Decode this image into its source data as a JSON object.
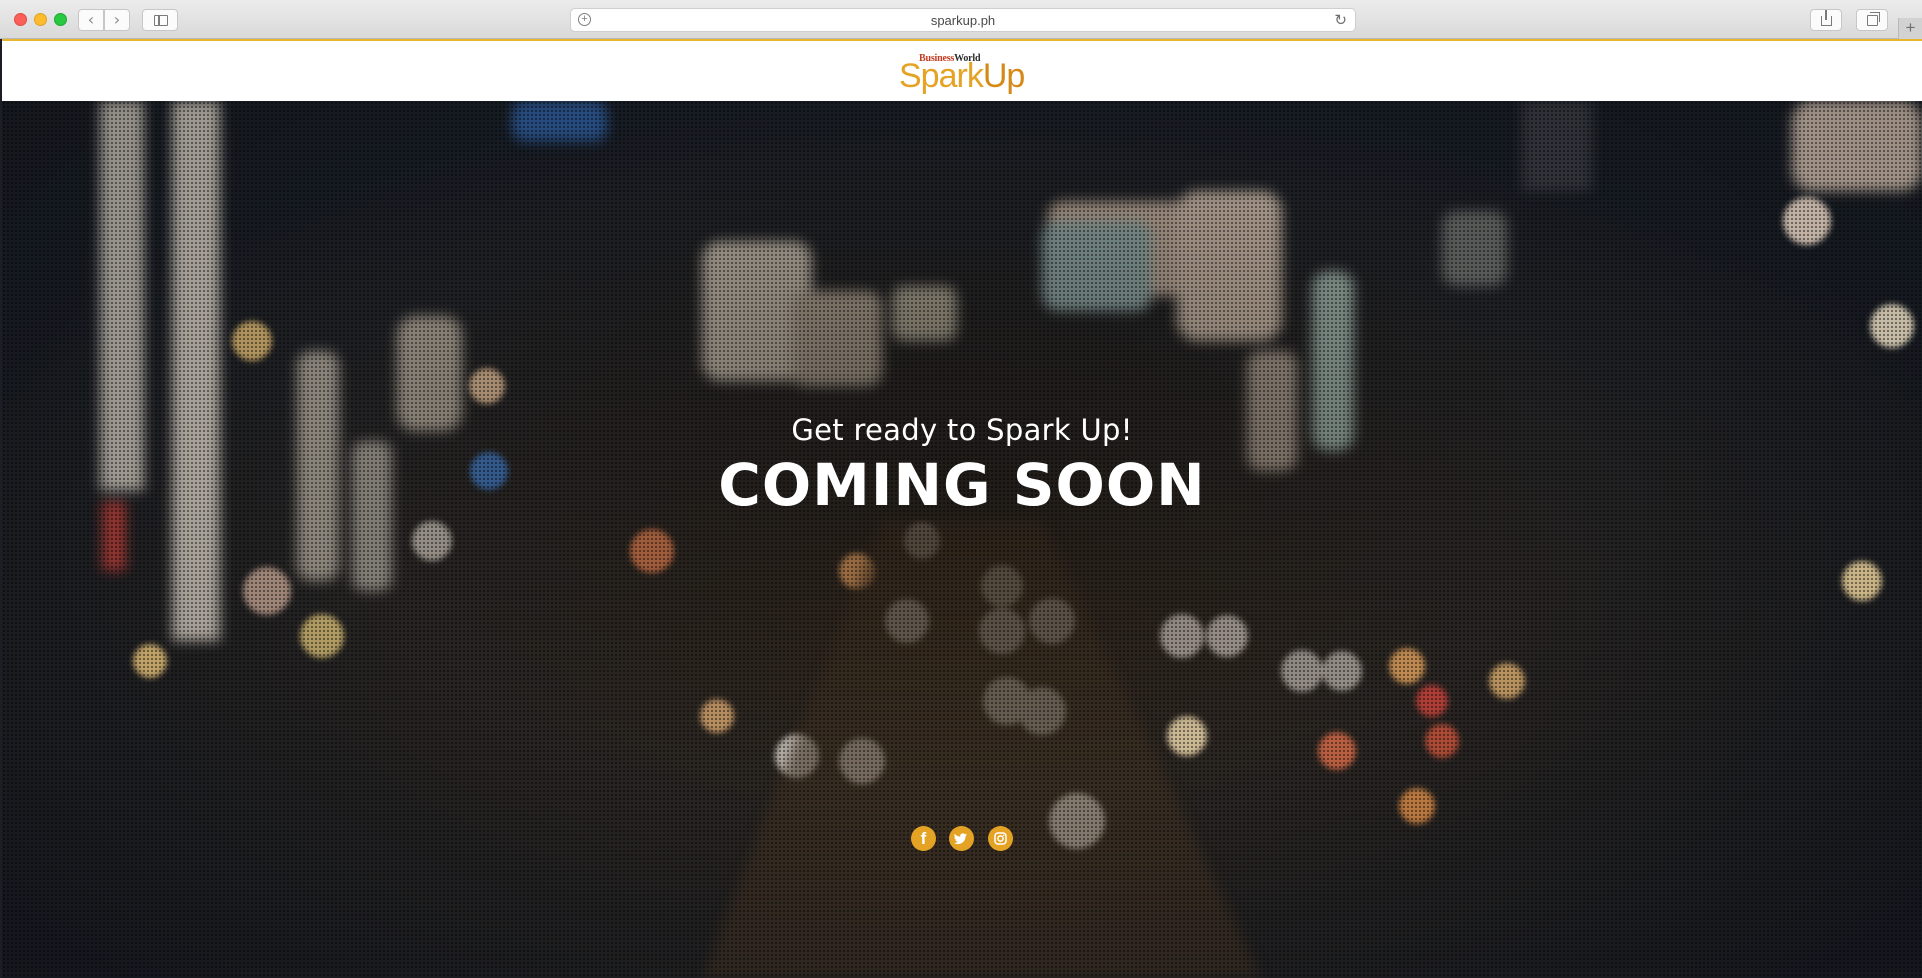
{
  "browser": {
    "url": "sparkup.ph",
    "back_icon": "chevron-left-icon",
    "forward_icon": "chevron-right-icon",
    "new_tab_label": "+"
  },
  "header": {
    "logo_business": "Business",
    "logo_world": "World",
    "logo_spark": "Spark",
    "logo_up": "Up",
    "accent_color": "#e5a325"
  },
  "hero": {
    "tagline": "Get ready to Spark Up!",
    "headline": "COMING SOON"
  },
  "social": {
    "items": [
      {
        "name": "facebook-icon",
        "glyph": "f"
      },
      {
        "name": "twitter-icon"
      },
      {
        "name": "instagram-icon"
      }
    ]
  }
}
